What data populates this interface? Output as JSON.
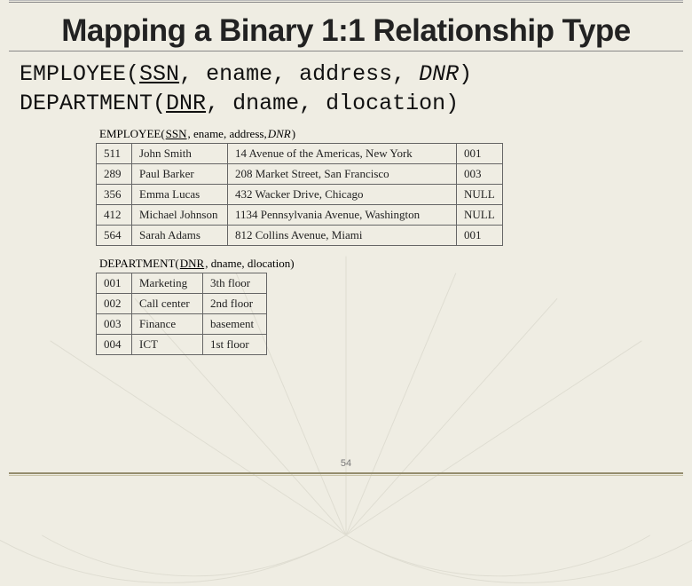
{
  "title": "Mapping a Binary 1:1 Relationship Type",
  "schema": {
    "employee": {
      "rel": "EMPLOYEE",
      "key": "SSN",
      "attrs_plain": ", ename, address, ",
      "fk": "DNR",
      "close": ")"
    },
    "department": {
      "rel": "DEPARTMENT",
      "key": "DNR",
      "attrs_plain": ", dname, dlocation)"
    }
  },
  "caption_emp": {
    "name": "EMPLOYEE(",
    "key": "SSN",
    "rest": ", ename, address, ",
    "fk": "DNR",
    "end": ")"
  },
  "caption_dept": {
    "name": "DEPARTMENT(",
    "key": "DNR",
    "rest": ", dname, dlocation)"
  },
  "employee_rows": [
    {
      "ssn": "511",
      "ename": "John Smith",
      "address": "14 Avenue of the Americas, New York",
      "dnr": "001"
    },
    {
      "ssn": "289",
      "ename": "Paul Barker",
      "address": "208 Market Street, San Francisco",
      "dnr": "003"
    },
    {
      "ssn": "356",
      "ename": "Emma Lucas",
      "address": "432 Wacker Drive, Chicago",
      "dnr": "NULL"
    },
    {
      "ssn": "412",
      "ename": "Michael Johnson",
      "address": "1134 Pennsylvania Avenue, Washington",
      "dnr": "NULL"
    },
    {
      "ssn": "564",
      "ename": "Sarah Adams",
      "address": "812 Collins Avenue, Miami",
      "dnr": "001"
    }
  ],
  "department_rows": [
    {
      "dnr": "001",
      "dname": "Marketing",
      "dlocation": "3th floor"
    },
    {
      "dnr": "002",
      "dname": "Call center",
      "dlocation": "2nd floor"
    },
    {
      "dnr": "003",
      "dname": "Finance",
      "dlocation": "basement"
    },
    {
      "dnr": "004",
      "dname": "ICT",
      "dlocation": "1st floor"
    }
  ],
  "page_number": "54"
}
